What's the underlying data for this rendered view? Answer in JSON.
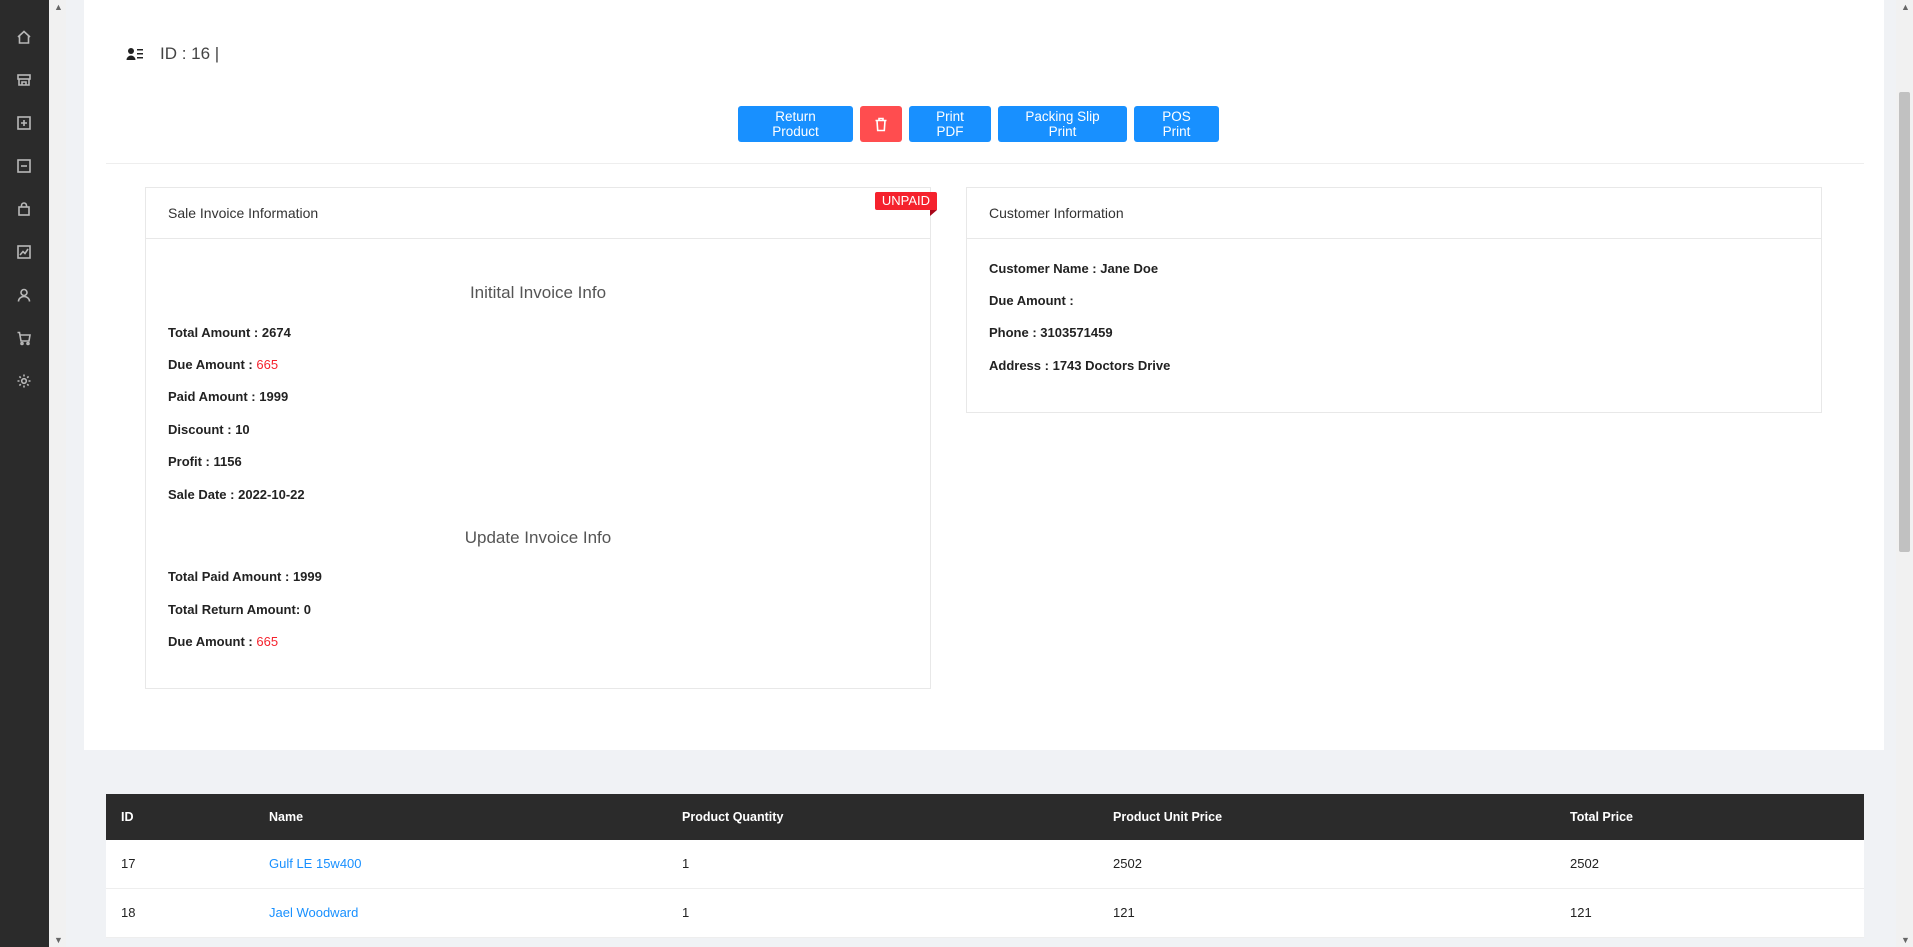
{
  "header": {
    "id_label": "ID : 16 |"
  },
  "actions": {
    "return_label": "Return Product",
    "print_pdf_label": "Print PDF",
    "packing_slip_label": "Packing Slip Print",
    "pos_print_label": "POS Print"
  },
  "invoice": {
    "panel_title": "Sale Invoice Information",
    "status_badge": "UNPAID",
    "initial_title": "Initital Invoice Info",
    "total_amount_label": "Total Amount :",
    "total_amount": "2674",
    "due_amount_label": "Due Amount :",
    "due_amount": "665",
    "paid_amount_label": "Paid Amount :",
    "paid_amount": "1999",
    "discount_label": "Discount :",
    "discount": "10",
    "profit_label": "Profit :",
    "profit": "1156",
    "sale_date_label": "Sale Date :",
    "sale_date": "2022-10-22",
    "update_title": "Update Invoice Info",
    "total_paid_label": "Total Paid Amount :",
    "total_paid": "1999",
    "total_return_label": "Total Return Amount:",
    "total_return": "0",
    "update_due_label": "Due Amount :",
    "update_due": "665"
  },
  "customer": {
    "panel_title": "Customer Information",
    "name_label": "Customer Name :",
    "name": "Jane Doe",
    "due_label": "Due Amount :",
    "due": "",
    "phone_label": "Phone :",
    "phone": "3103571459",
    "address_label": "Address :",
    "address": "1743 Doctors Drive"
  },
  "table": {
    "columns": [
      "ID",
      "Name",
      "Product Quantity",
      "Product Unit Price",
      "Total Price"
    ],
    "rows": [
      {
        "id": "17",
        "name": "Gulf LE 15w400",
        "qty": "1",
        "unit_price": "2502",
        "total": "2502"
      },
      {
        "id": "18",
        "name": "Jael Woodward",
        "qty": "1",
        "unit_price": "121",
        "total": "121"
      }
    ]
  },
  "sidebar": {
    "icons": [
      "home-icon",
      "shop-icon",
      "add-box-icon",
      "minus-box-icon",
      "bag-icon",
      "chart-icon",
      "user-icon",
      "cart-icon",
      "settings-icon"
    ]
  },
  "colors": {
    "primary": "#1890ff",
    "danger": "#ff4d4f",
    "badge": "#f5222d",
    "sidebar": "#2b2b2b"
  }
}
